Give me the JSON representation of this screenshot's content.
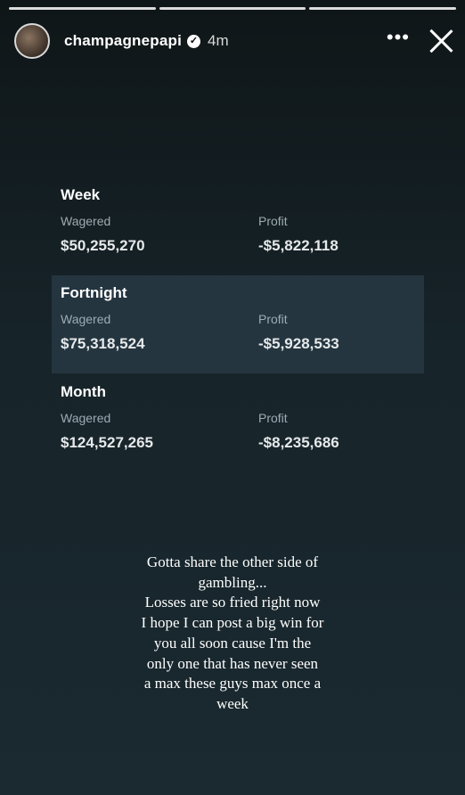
{
  "story": {
    "username": "champagnepapi",
    "time_ago": "4m",
    "more_glyph": "•••"
  },
  "stats": [
    {
      "title": "Week",
      "wagered_label": "Wagered",
      "wagered": "$50,255,270",
      "profit_label": "Profit",
      "profit": "-$5,822,118"
    },
    {
      "title": "Fortnight",
      "wagered_label": "Wagered",
      "wagered": "$75,318,524",
      "profit_label": "Profit",
      "profit": "-$5,928,533"
    },
    {
      "title": "Month",
      "wagered_label": "Wagered",
      "wagered": "$124,527,265",
      "profit_label": "Profit",
      "profit": "-$8,235,686"
    }
  ],
  "caption_lines": [
    "Gotta share the other side of",
    "gambling...",
    "Losses are so fried right now",
    "I hope I can post a big win for",
    "you all soon cause I'm the",
    "only one that has never seen",
    "a max these guys max once a",
    "week"
  ]
}
